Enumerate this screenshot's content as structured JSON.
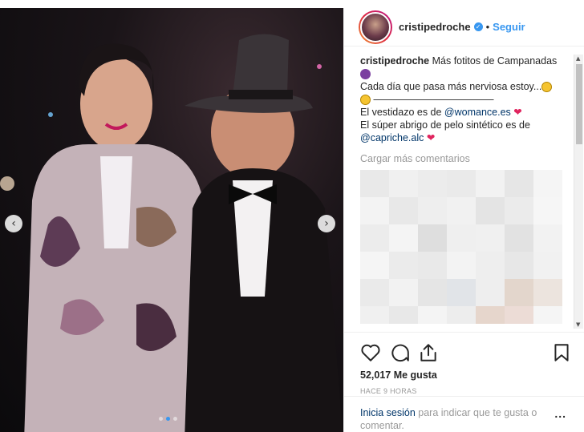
{
  "post": {
    "image_alt": "Two people posing at an outdoor night event with string lights",
    "carousel_dots": 3,
    "active_dot": 1
  },
  "header": {
    "username": "cristipedroche",
    "separator": "•",
    "follow_label": "Seguir"
  },
  "caption": {
    "username": "cristipedroche",
    "line1": "Más fotitos de Campanadas",
    "line2": "Cada día que pasa más nerviosa estoy...",
    "divider": "————————————",
    "dress_prefix": "El vestidazo es de ",
    "dress_mention": "@womance.es",
    "coat_text": "El súper abrigo de pelo sintético es de",
    "coat_mention": "@capriche.alc",
    "heart": "❤"
  },
  "comments": {
    "load_more": "Cargar más comentarios"
  },
  "actions": {
    "likes": "52,017 Me gusta",
    "time": "HACE 9 HORAS"
  },
  "login": {
    "link": "Inicia sesión",
    "text": " para indicar que te gusta o comentar.",
    "more": "..."
  },
  "colors": {
    "link_blue": "#3897f0",
    "mention_blue": "#003569",
    "heart_red": "#e0245e",
    "muted": "#999999"
  },
  "icons": [
    "verified-icon",
    "heart-icon",
    "comment-icon",
    "share-icon",
    "bookmark-icon",
    "chevron-left-icon",
    "chevron-right-icon",
    "more-icon"
  ]
}
